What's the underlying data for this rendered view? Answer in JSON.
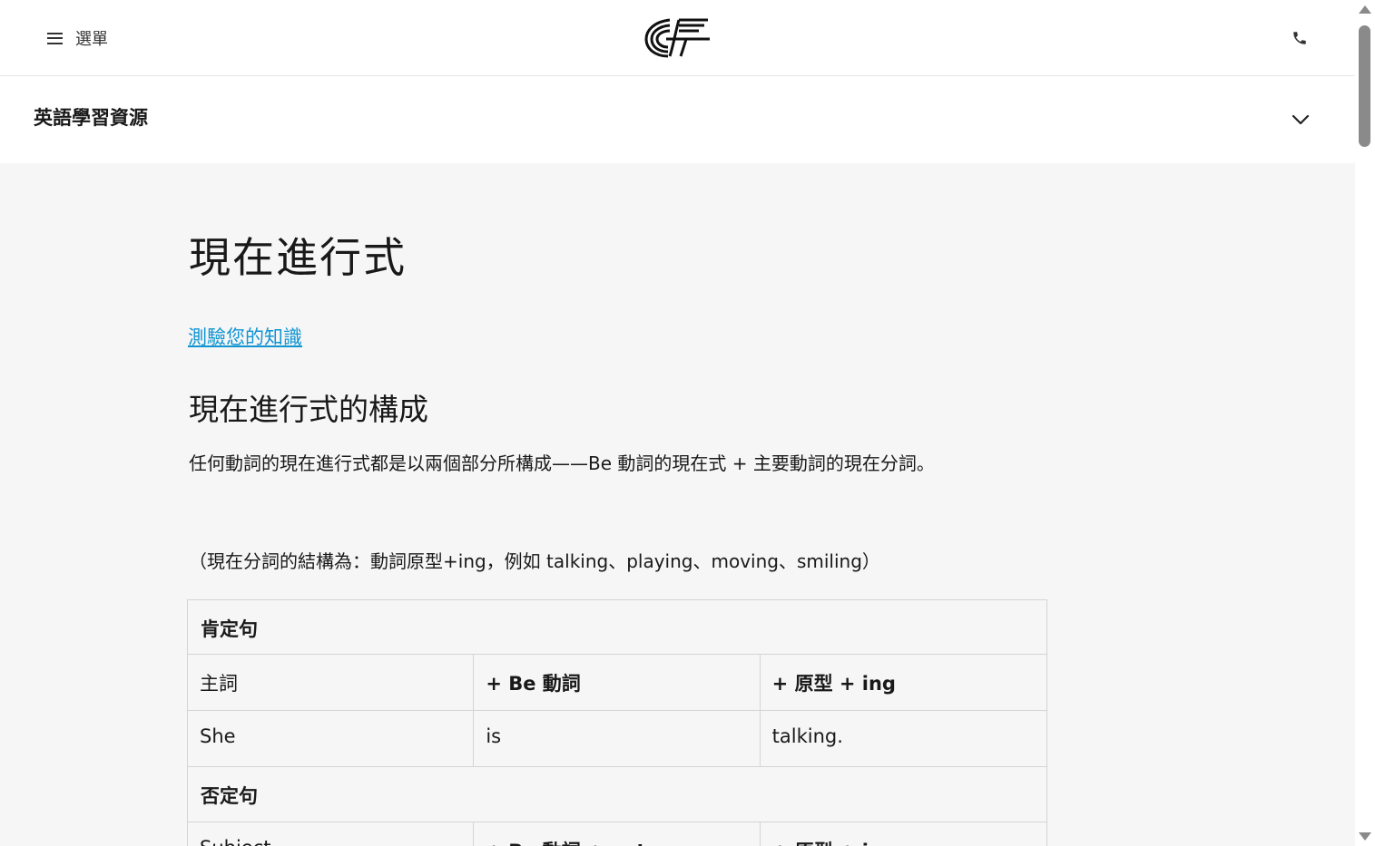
{
  "header": {
    "menu_label": "選單",
    "logo_icon": "ef-logo-icon",
    "phone_icon": "phone-icon"
  },
  "subnav": {
    "title": "英語學習資源",
    "expand_icon": "chevron-down-icon"
  },
  "main": {
    "title": "現在進行式",
    "quiz_link": "測驗您的知識",
    "subtitle": "現在進行式的構成",
    "paragraph1": "任何動詞的現在進行式都是以兩個部分所構成——Be 動詞的現在式 + 主要動詞的現在分詞。",
    "paragraph2": "（現在分詞的結構為：動詞原型+ing，例如 talking、playing、moving、smiling）"
  },
  "grammar_table": {
    "affirmative": {
      "label": "肯定句",
      "columns": [
        "主詞",
        "+ Be 動詞",
        "+ 原型 + ing"
      ],
      "example": [
        "She",
        "is",
        "talking."
      ]
    },
    "negative": {
      "label": "否定句",
      "columns": [
        "Subject",
        "+ Be 動詞 + not",
        "+ 原型 + ing"
      ]
    }
  },
  "colors": {
    "link": "#0f94d2",
    "text": "#191919",
    "page_bg": "#f6f6f6"
  }
}
